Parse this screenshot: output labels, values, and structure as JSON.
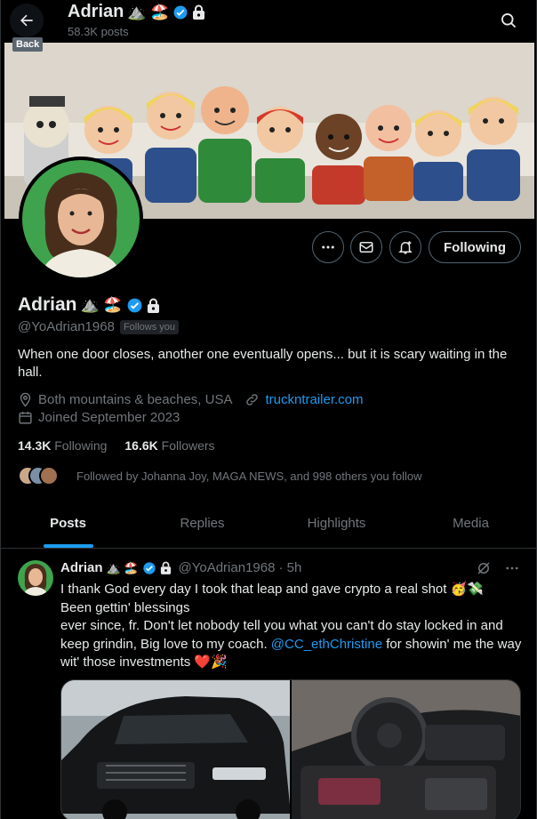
{
  "header": {
    "back_tooltip": "Back",
    "name": "Adrian",
    "name_emojis": "⛰️ 🏖️",
    "posts_count": "58.3K posts",
    "icons": {
      "back": "arrow-left-icon",
      "search": "search-icon"
    }
  },
  "profile": {
    "name": "Adrian",
    "name_emojis": "⛰️ 🏖️",
    "handle": "@YoAdrian1968",
    "follows_you": "Follows you",
    "bio": "When one door closes, another one eventually opens... but it is scary waiting in the hall.",
    "location": "Both mountains & beaches, USA",
    "website": "truckntrailer.com",
    "joined": "Joined September 2023",
    "following_count": "14.3K",
    "following_label": "Following",
    "followers_count": "16.6K",
    "followers_label": "Followers",
    "followed_by": "Followed by Johanna Joy, MAGA NEWS, and 998 others you follow",
    "follow_button": "Following",
    "icons": [
      "more-icon",
      "message-icon",
      "notification-bell-icon",
      "verified-icon",
      "lock-icon",
      "location-pin-icon",
      "link-icon",
      "calendar-icon"
    ]
  },
  "tabs": [
    {
      "label": "Posts",
      "active": true
    },
    {
      "label": "Replies",
      "active": false
    },
    {
      "label": "Highlights",
      "active": false
    },
    {
      "label": "Media",
      "active": false
    }
  ],
  "post": {
    "author": "Adrian",
    "author_emojis": "⛰️ 🏖️",
    "handle": "@YoAdrian1968",
    "time": "· 5h",
    "line1": "I thank God every day I took that leap and gave crypto a real shot 🥳💸",
    "line2": "Been gettin' blessings",
    "line3_a": "ever since, fr. Don't let nobody tell you what you can't do stay locked in and keep grindin, Big love to my coach. ",
    "mention": "@CC_ethChristine",
    "line3_b": " for showin' me the way wit' those investments ❤️🎉"
  },
  "colors": {
    "background": "#000000",
    "text": "#e7e9ea",
    "muted": "#71767b",
    "accent": "#1d9bf0",
    "border": "#2f3336"
  }
}
